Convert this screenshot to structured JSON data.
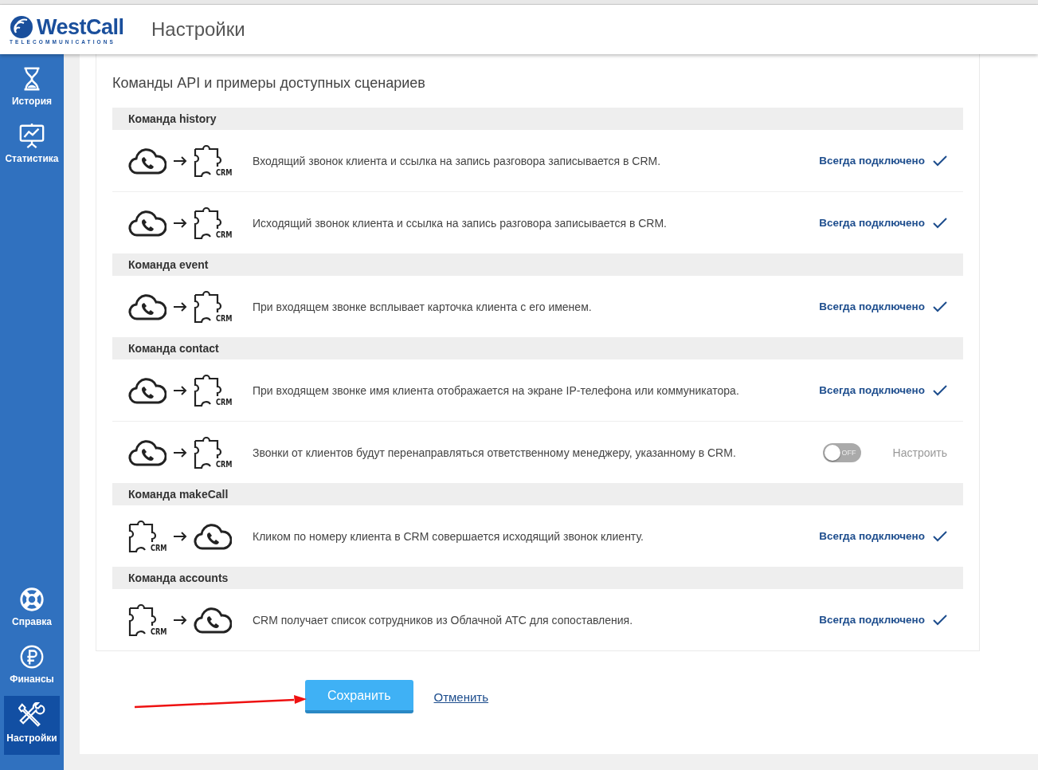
{
  "header": {
    "logo_name": "WestCall",
    "logo_tagline": "TELECOMMUNICATIONS",
    "title": "Настройки"
  },
  "sidebar": {
    "top_items": [
      {
        "label": "История",
        "kind": "hourglass",
        "selected": false
      },
      {
        "label": "Статистика",
        "kind": "chart",
        "selected": false
      }
    ],
    "bottom_items": [
      {
        "label": "Справка",
        "kind": "lifebuoy",
        "selected": false
      },
      {
        "label": "Финансы",
        "kind": "ruble",
        "selected": false
      },
      {
        "label": "Настройки",
        "kind": "tools",
        "selected": true
      }
    ]
  },
  "card": {
    "title": "Команды API и примеры доступных сценариев",
    "sections": [
      {
        "heading": "Команда history",
        "scenarios": [
          {
            "kind": "cloud-to-crm",
            "crm_label": "CRM",
            "description": "Входящий звонок клиента и ссылка на запись разговора записывается в CRM.",
            "status": {
              "kind": "always",
              "text": "Всегда подключено"
            }
          },
          {
            "kind": "cloud-to-crm",
            "crm_label": "CRM",
            "description": "Исходящий звонок клиента и ссылка на запись разговора записывается в CRM.",
            "status": {
              "kind": "always",
              "text": "Всегда подключено"
            }
          }
        ]
      },
      {
        "heading": "Команда event",
        "scenarios": [
          {
            "kind": "cloud-to-crm",
            "crm_label": "CRM",
            "description": "При входящем звонке всплывает карточка клиента с его именем.",
            "status": {
              "kind": "always",
              "text": "Всегда подключено"
            }
          }
        ]
      },
      {
        "heading": "Команда contact",
        "scenarios": [
          {
            "kind": "cloud-to-crm",
            "crm_label": "CRM",
            "description": "При входящем звонке имя клиента отображается на экране IP-телефона или коммуникатора.",
            "status": {
              "kind": "always",
              "text": "Всегда подключено"
            }
          },
          {
            "kind": "cloud-to-crm",
            "crm_label": "CRM",
            "description": "Звонки от клиентов будут перенаправляться ответственному менеджеру, указанному в CRM.",
            "status": {
              "kind": "toggle",
              "on": false,
              "toggle_text": "OFF",
              "link": "Настроить"
            }
          }
        ]
      },
      {
        "heading": "Команда makeCall",
        "scenarios": [
          {
            "kind": "crm-to-cloud",
            "crm_label": "CRM",
            "description": "Кликом по номеру клиента в CRM совершается исходящий звонок клиенту.",
            "status": {
              "kind": "always",
              "text": "Всегда подключено"
            }
          }
        ]
      },
      {
        "heading": "Команда accounts",
        "scenarios": [
          {
            "kind": "crm-to-cloud",
            "crm_label": "CRM",
            "description": "CRM получает список сотрудников из Облачной АТС для сопоставления.",
            "status": {
              "kind": "always",
              "text": "Всегда подключено"
            }
          }
        ]
      }
    ]
  },
  "actions": {
    "save": "Сохранить",
    "cancel": "Отменить"
  }
}
